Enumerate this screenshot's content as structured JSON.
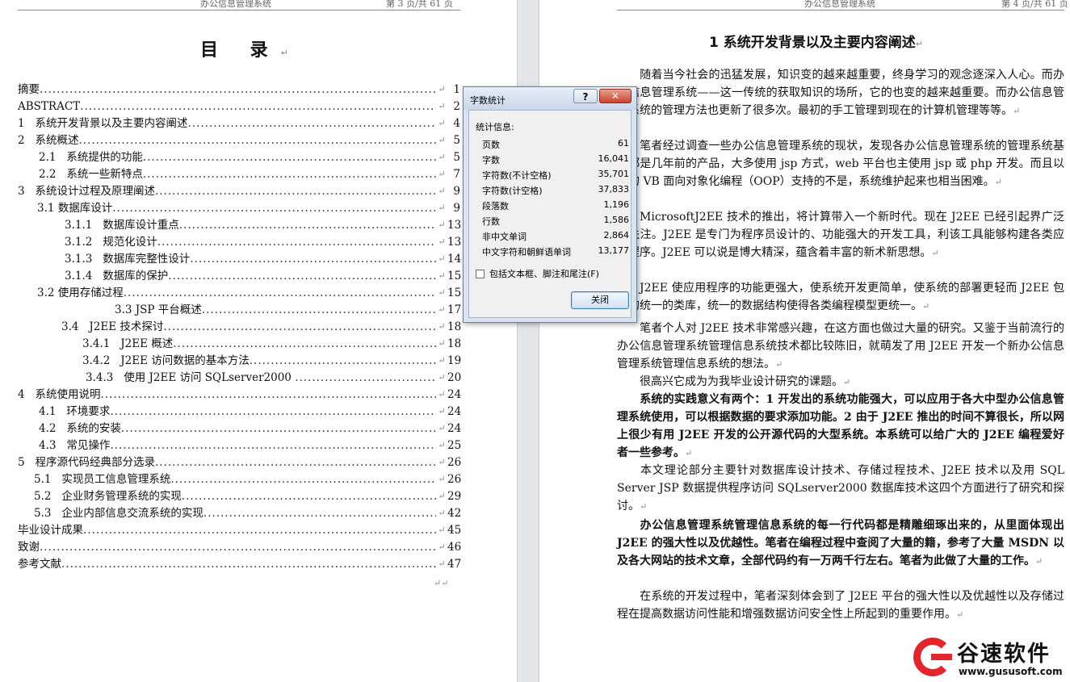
{
  "left_page": {
    "header_left": "办公信息管理系统",
    "header_right": "第 3 页/共 61 页",
    "toc_title": "目  录",
    "para_mark": "↵",
    "toc": [
      {
        "text": "摘要",
        "page": "1"
      },
      {
        "text": "ABSTRACT",
        "page": "2"
      },
      {
        "text": "1   系统开发背景以及主要内容阐述",
        "page": "4"
      },
      {
        "text": "2   系统概述",
        "page": "5"
      },
      {
        "text": "2.1   系统提供的功能",
        "page": "5"
      },
      {
        "text": "2.2   系统一些新特点",
        "page": "7"
      },
      {
        "text": "3   系统设计过程及原理阐述",
        "page": "9"
      },
      {
        "text": "3.1 数据库设计",
        "page": "9"
      },
      {
        "text": "3.1.1   数据库设计重点",
        "page": "13"
      },
      {
        "text": "3.1.2   规范化设计",
        "page": "13"
      },
      {
        "text": "3.1.3   数据库完整性设计",
        "page": "14"
      },
      {
        "text": "3.1.4   数据库的保护",
        "page": "15"
      },
      {
        "text": "3.2 使用存储过程",
        "page": "15"
      },
      {
        "text": "3.3 JSP 平台概述",
        "page": "17"
      },
      {
        "text": "3.4   J2EE 技术探讨",
        "page": "18"
      },
      {
        "text": "3.4.1   J2EE 概述",
        "page": "18"
      },
      {
        "text": "3.4.2   J2EE 访问数据的基本方法",
        "page": "19"
      },
      {
        "text": "3.4.3   使用 J2EE 访问 SQLserver2000 ",
        "page": "20"
      },
      {
        "text": "4   系统使用说明",
        "page": "24"
      },
      {
        "text": "4.1   环境要求",
        "page": "24"
      },
      {
        "text": "4.2   系统的安装",
        "page": "24"
      },
      {
        "text": "4.3   常见操作",
        "page": "25"
      },
      {
        "text": "5   程序源代码经典部分选录",
        "page": "26"
      },
      {
        "text": "5.1   实现员工信息管理系统",
        "page": "26"
      },
      {
        "text": "5.2   企业财务管理系统的实现",
        "page": "29"
      },
      {
        "text": "5.3   企业内部信息交流系统的实现",
        "page": "42"
      },
      {
        "text": "毕业设计成果",
        "page": "45"
      },
      {
        "text": "致谢",
        "page": "46"
      },
      {
        "text": "参考文献",
        "page": "47"
      }
    ]
  },
  "right_page": {
    "header_left": "办公信息管理系统",
    "header_right": "第 4 页/共 61 页",
    "title": "1  系统开发背景以及主要内容阐述",
    "paragraphs": [
      {
        "text": "随着当今社会的迅猛发展，知识变的越来越重要，终身学习的观念逐深入人心。而办公信息管理系统——这一传统的获取知识的场所，它的也变的越来越重要。而办公信息管理系统的管理方法也更新了很多次。最初的手工管理到现在的计算机管理等等。",
        "bold": false
      },
      {
        "text": "笔者经过调查一些办公信息管理系统的现状，发现各办公信息管理系统的管理系统基本都是几年前的产品，大多使用 jsp 方式，web 平台也主使用 jsp 或 php 开发。而且以前的 VB 面向对象化编程（OOP）支持的不是，系统维护起来也相当困难。",
        "bold": false
      },
      {
        "text": "MicrosoftJ2EE 技术的推出，将计算带入一个新时代。现在 J2EE 已经引起界广泛的关注。J2EE 是专门为程序员设计的、功能强大的开发工具，利该工具能够构建各类应用程序。J2EE 可以说是博大精深，蕴含着丰富的新术新思想。",
        "bold": false
      },
      {
        "text": "J2EE 使应用程序的功能更强大，使系统开发更简单，使系统的部署更轻而 J2EE 包含的统一的类库，统一的数据结构使得各类编程模型更统一。",
        "bold": false
      },
      {
        "text": "笔者个人对 J2EE 技术非常感兴趣，在这方面也做过大量的研究。又鉴于当前流行的办公信息管理系统管理信息系统技术都比较陈旧，就萌发了用 J2EE 开发一个新办公信息管理系统管理信息系统的想法。",
        "bold": false
      },
      {
        "text": "很高兴它成为为我毕业设计研究的课题。",
        "bold": false
      },
      {
        "text": "系统的实践意义有两个：1 开发出的系统功能强大，可以应用于各大中型办公信息管理系统使用，可以根据数据的要求添加功能。2 由于 J2EE 推出的时间不算很长，所以网上很少有用 J2EE 开发的公开源代码的大型系统。本系统可以给广大的 J2EE 编程爱好者一些参考。",
        "bold": true
      },
      {
        "text": "本文理论部分主要针对数据库设计技术、存储过程技术、J2EE 技术以及用 SQL Server JSP 数据提供程序访问 SQLserver2000 数据库技术这四个方面进行了研究和探讨。",
        "bold": false
      },
      {
        "text": "办公信息管理系统管理信息系统的每一行代码都是精雕细琢出来的，从里面体现出 J2EE 的强大性以及优越性。笔者在编程过程中查阅了大量的籍，参考了大量 MSDN 以及各大网站的技术文章，全部代码约有一万两千行左右。笔者为此做了大量的工作。",
        "bold": true
      },
      {
        "text": "在系统的开发过程中，笔者深刻体会到了 J2EE 平台的强大性以及优越性以及存储过程在提高数据访问性能和增强数据访问安全性上所起到的重要作用。",
        "bold": false
      }
    ]
  },
  "dialog": {
    "title": "字数统计",
    "help": "?",
    "close_x": "✕",
    "group_label": "统计信息:",
    "stats": [
      {
        "label": "页数",
        "value": "61"
      },
      {
        "label": "字数",
        "value": "16,041"
      },
      {
        "label": "字符数(不计空格)",
        "value": "35,701"
      },
      {
        "label": "字符数(计空格)",
        "value": "37,833"
      },
      {
        "label": "段落数",
        "value": "1,196"
      },
      {
        "label": "行数",
        "value": "1,586"
      },
      {
        "label": "非中文单词",
        "value": "2,864"
      },
      {
        "label": "中文字符和朝鲜语单词",
        "value": "13,177"
      }
    ],
    "checkbox_label": "包括文本框、脚注和尾注(F)",
    "checkbox_checked": false,
    "close_button": "关闭"
  },
  "watermark": {
    "brand": "谷速软件",
    "url": "www.gususoft.com",
    "color": "#e3262d"
  }
}
